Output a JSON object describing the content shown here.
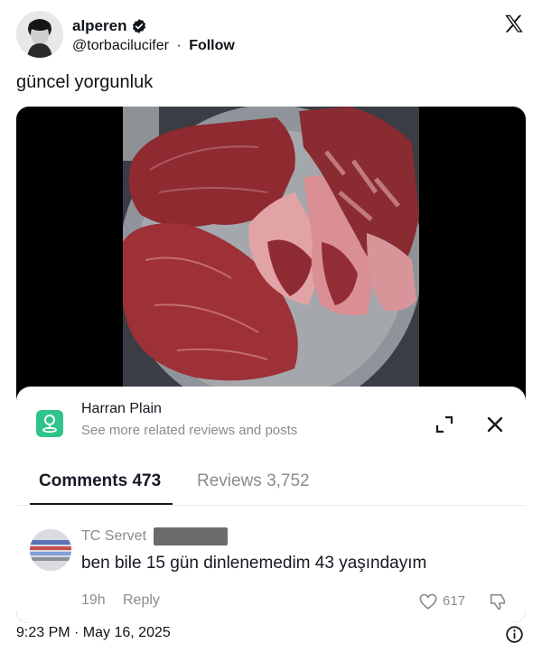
{
  "tweet": {
    "author": {
      "display_name": "alperen",
      "handle": "@torbacilucifer",
      "separator": "·",
      "follow_label": "Follow",
      "verified": true
    },
    "text": "güncel yorgunluk",
    "timestamp": "9:23 PM · May 16, 2025",
    "brand_icon": "x-logo-icon",
    "info_icon": "info-icon"
  },
  "media": {
    "sheet": {
      "place_name": "Harran Plain",
      "place_subtitle": "See more related reviews and posts",
      "place_icon": "location-pin-icon",
      "accent_color": "#2ec48a"
    },
    "tabs": [
      {
        "label": "Comments 473",
        "active": true
      },
      {
        "label": "Reviews 3,752",
        "active": false
      }
    ],
    "comment": {
      "username": "TC Servet",
      "text": "ben bile 15 gün dinlenemedim 43 yaşındayım",
      "time": "19h",
      "reply_label": "Reply",
      "like_count": "617"
    }
  }
}
